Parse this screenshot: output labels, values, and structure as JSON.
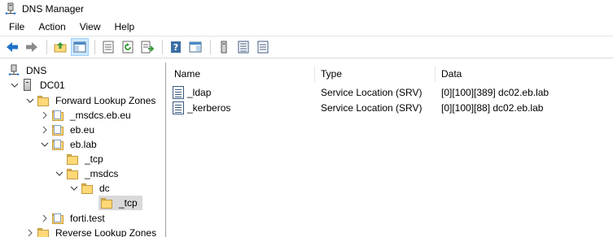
{
  "window": {
    "title": "DNS Manager",
    "app_icon": "dns-manager-icon"
  },
  "menu": {
    "items": [
      "File",
      "Action",
      "View",
      "Help"
    ]
  },
  "toolbar": {
    "buttons": [
      "back-arrow-icon",
      "forward-arrow-icon",
      "up-folder-icon",
      "show-hide-tree-icon",
      "properties-icon",
      "refresh-icon",
      "export-list-icon",
      "help-icon",
      "console-icon",
      "server-icon",
      "zone-list-icon",
      "record-list-icon"
    ]
  },
  "tree": {
    "items": [
      {
        "label": "DNS",
        "icon": "dns-icon",
        "expanded": true,
        "level": 0
      },
      {
        "label": "DC01",
        "icon": "server-icon",
        "expanded": true,
        "level": 1
      },
      {
        "label": "Forward Lookup Zones",
        "icon": "folder-icon",
        "expanded": true,
        "level": 2
      },
      {
        "label": "_msdcs.eb.eu",
        "icon": "zone-icon",
        "expanded": false,
        "level": 3
      },
      {
        "label": "eb.eu",
        "icon": "zone-icon",
        "expanded": false,
        "level": 3
      },
      {
        "label": "eb.lab",
        "icon": "zone-icon",
        "expanded": true,
        "level": 3
      },
      {
        "label": "_tcp",
        "icon": "folder-icon",
        "level": 4
      },
      {
        "label": "_msdcs",
        "icon": "folder-icon",
        "expanded": true,
        "level": 4
      },
      {
        "label": "dc",
        "icon": "folder-icon",
        "expanded": true,
        "level": 5
      },
      {
        "label": "_tcp",
        "icon": "folder-icon",
        "level": 6,
        "selected": true
      },
      {
        "label": "forti.test",
        "icon": "zone-icon",
        "expanded": false,
        "level": 3
      },
      {
        "label": "Reverse Lookup Zones",
        "icon": "folder-icon",
        "expanded": false,
        "level": 2
      }
    ]
  },
  "list": {
    "columns": [
      "Name",
      "Type",
      "Data"
    ],
    "rows": [
      {
        "name": "_ldap",
        "type": "Service Location (SRV)",
        "data": "[0][100][389] dc02.eb.lab"
      },
      {
        "name": "_kerberos",
        "type": "Service Location (SRV)",
        "data": "[0][100][88] dc02.eb.lab"
      }
    ]
  }
}
